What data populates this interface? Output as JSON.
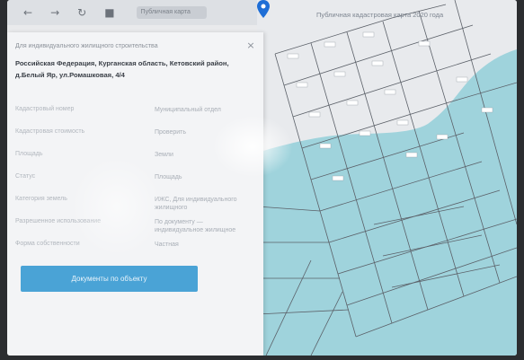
{
  "toolbar": {
    "icons": [
      "back-arrow-icon",
      "forward-arrow-icon",
      "reload-icon",
      "lock-icon"
    ],
    "icon_glyphs": [
      "←",
      "→",
      "↻",
      "■"
    ],
    "url_text": "Публичная карта"
  },
  "map": {
    "title": "Публичная кадастровая карта 2020 года",
    "water_color": "#9fd3dc",
    "line_color": "#5b6068",
    "marker_color": "#1e6ed6"
  },
  "panel": {
    "subtitle": "Для индивидуального жилищного строительства",
    "address": "Российская Федерация, Курганская область, Кетовский район, д.Белый Яр, ул.Ромашковая, 4/4",
    "rows": [
      {
        "key": "Кадастровый номер",
        "value": "Муниципальный отдел"
      },
      {
        "key": "Кадастровая стоимость",
        "value": "Проверить"
      },
      {
        "key": "Площадь",
        "value": "Земли"
      },
      {
        "key": "Статус",
        "value": "Площадь"
      },
      {
        "key": "Категория земель",
        "value": "ИЖС, Для индивидуального жилищного"
      },
      {
        "key": "Разрешенное использование",
        "value": "По документу — индивидуальное жилищное"
      },
      {
        "key": "Форма собственности",
        "value": "Частная"
      }
    ],
    "close_glyph": "×",
    "documents_button": "Документы по объекту"
  }
}
